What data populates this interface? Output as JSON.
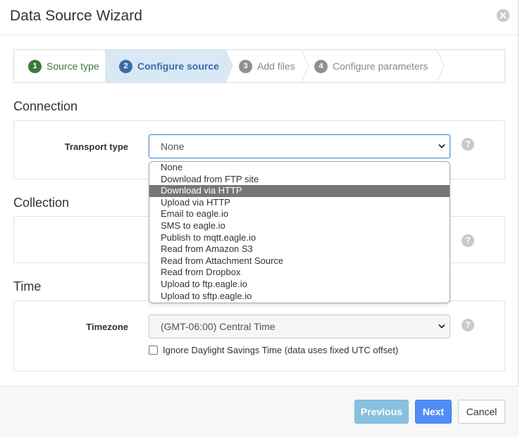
{
  "dialog": {
    "title": "Data Source Wizard"
  },
  "wizard": {
    "steps": [
      {
        "num": "1",
        "label": "Source type"
      },
      {
        "num": "2",
        "label": "Configure source"
      },
      {
        "num": "3",
        "label": "Add files"
      },
      {
        "num": "4",
        "label": "Configure parameters"
      }
    ]
  },
  "connection": {
    "section_title": "Connection",
    "transport_label": "Transport type",
    "transport_value": "None",
    "transport_options": [
      "None",
      "Download from FTP site",
      "Download via HTTP",
      "Upload via HTTP",
      "Email to eagle.io",
      "SMS to eagle.io",
      "Publish to mqtt.eagle.io",
      "Read from Amazon S3",
      "Read from Attachment Source",
      "Read from Dropbox",
      "Upload to ftp.eagle.io",
      "Upload to sftp.eagle.io"
    ],
    "highlighted_option": "Download via HTTP"
  },
  "collection": {
    "section_title": "Collection"
  },
  "time": {
    "section_title": "Time",
    "timezone_label": "Timezone",
    "timezone_value": "(GMT-06:00) Central Time",
    "dst_label": "Ignore Daylight Savings Time (data uses fixed UTC offset)"
  },
  "help_glyph": "?",
  "footer": {
    "previous": "Previous",
    "next": "Next",
    "cancel": "Cancel"
  },
  "colors": {
    "step_done": "#3b7a3a",
    "step_active": "#3a6ea5",
    "step_active_bg": "#d9e8f5",
    "primary": "#4f8ef7",
    "previous_disabled": "#88c0e0",
    "dropdown_highlight": "#767676"
  }
}
